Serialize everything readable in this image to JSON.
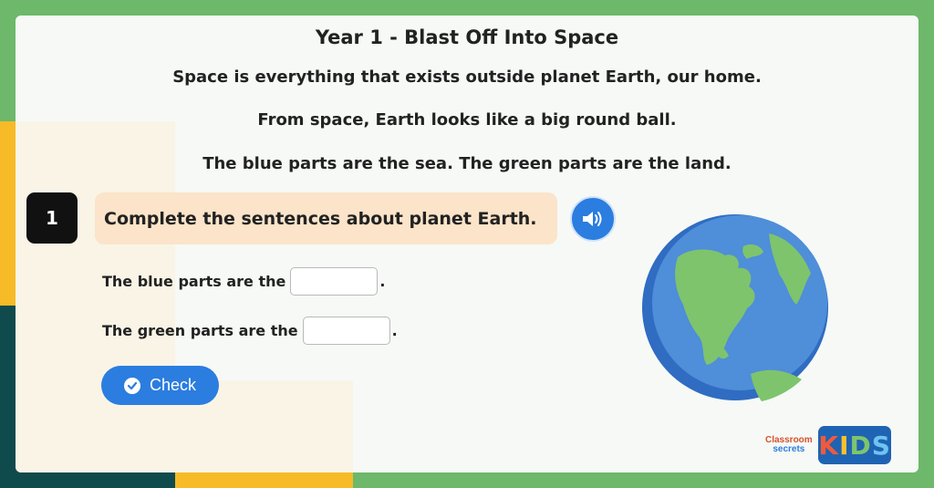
{
  "title": "Year 1 - Blast Off Into Space",
  "intro": [
    "Space is everything that exists outside planet Earth, our home.",
    "From space, Earth looks like a big round ball.",
    "The blue parts are the sea. The green parts are the land."
  ],
  "question": {
    "number": "1",
    "prompt": "Complete the sentences about planet Earth.",
    "audio_icon": "speaker-icon"
  },
  "sentences": [
    {
      "text": "The blue parts are the",
      "end": ".",
      "value": ""
    },
    {
      "text": "The green parts are the",
      "end": ".",
      "value": ""
    }
  ],
  "check_button": {
    "label": "Check",
    "icon": "check-circle-icon"
  },
  "brand": {
    "line1": "Classroom",
    "line2": "secrets",
    "kids_letters": [
      "K",
      "I",
      "D",
      "S"
    ]
  },
  "colors": {
    "background_green": "#6db86b",
    "accent_blue": "#2b7de0",
    "question_box": "#fbe4c9",
    "yellow": "#f6bb26",
    "dark_teal": "#0f4a4d"
  }
}
